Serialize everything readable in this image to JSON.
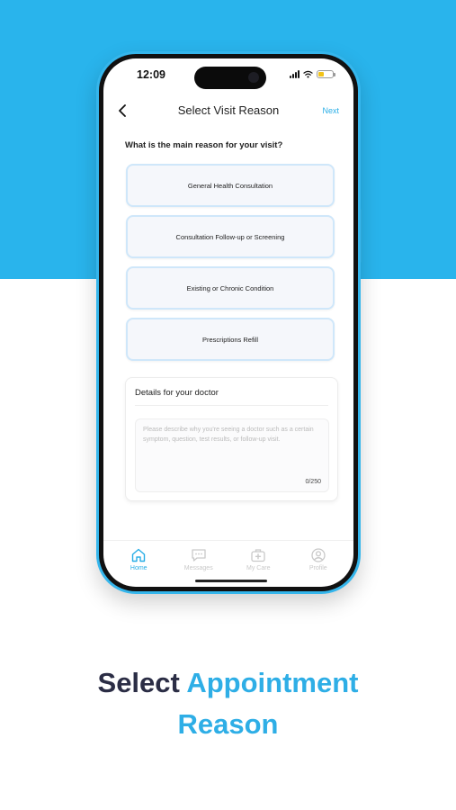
{
  "status_bar": {
    "time": "12:09"
  },
  "header": {
    "title": "Select Visit Reason",
    "next_label": "Next"
  },
  "question": "What is the main reason for your visit?",
  "reasons": [
    "General Health Consultation",
    "Consultation Follow-up or Screening",
    "Existing or Chronic Condition",
    "Prescriptions Refill"
  ],
  "details": {
    "title": "Details for your doctor",
    "placeholder": "Please describe why you're seeing a doctor such as a certain symptom, question, test results, or follow-up visit.",
    "counter": "0/250"
  },
  "nav": [
    {
      "label": "Home",
      "icon": "home-icon",
      "active": true
    },
    {
      "label": "Messages",
      "icon": "message-icon",
      "active": false
    },
    {
      "label": "My Care",
      "icon": "medical-kit-icon",
      "active": false
    },
    {
      "label": "Profile",
      "icon": "profile-icon",
      "active": false
    }
  ],
  "caption": {
    "dark": "Select",
    "blue_1": "Appointment",
    "blue_2": "Reason"
  },
  "colors": {
    "accent": "#29b4ec",
    "caption_dark": "#2b2d45",
    "battery": "#f2c318"
  }
}
